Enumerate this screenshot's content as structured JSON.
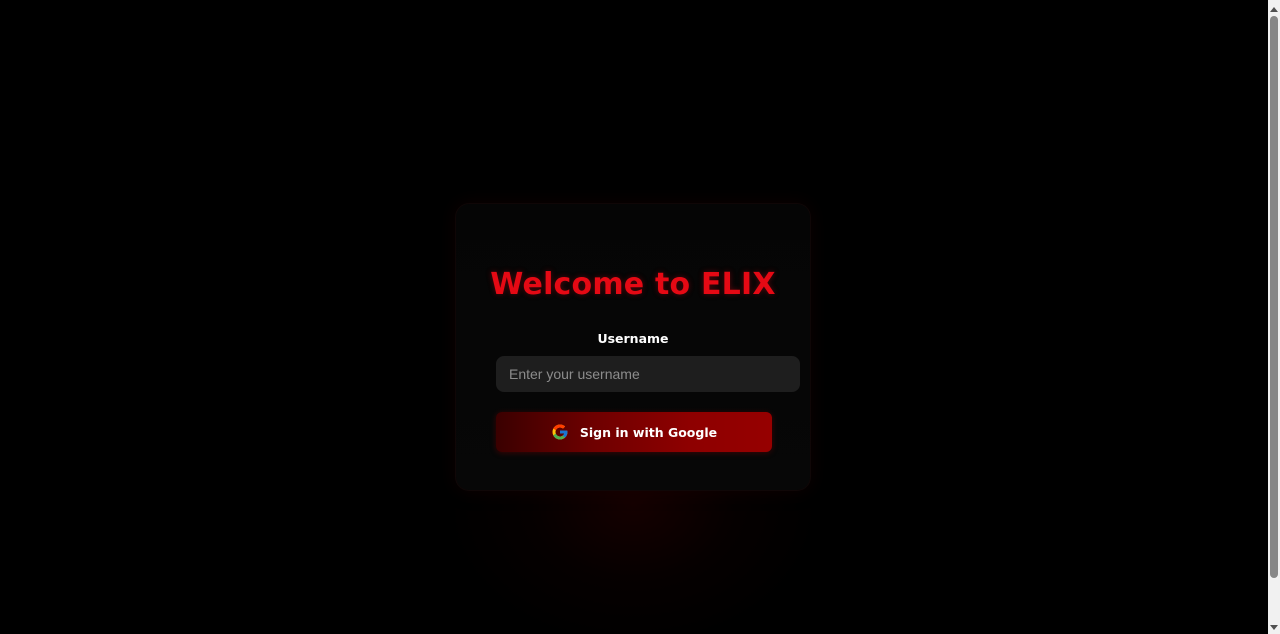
{
  "login": {
    "title": "Welcome to ELIX",
    "username_label": "Username",
    "username_placeholder": "Enter your username",
    "username_value": "",
    "google_button_label": "Sign in with Google",
    "google_icon": "google-g-icon"
  },
  "colors": {
    "background": "#000000",
    "accent": "#e50914",
    "button_gradient_start": "#3a0000",
    "button_gradient_end": "#960000",
    "input_background": "#1e1e1e"
  }
}
